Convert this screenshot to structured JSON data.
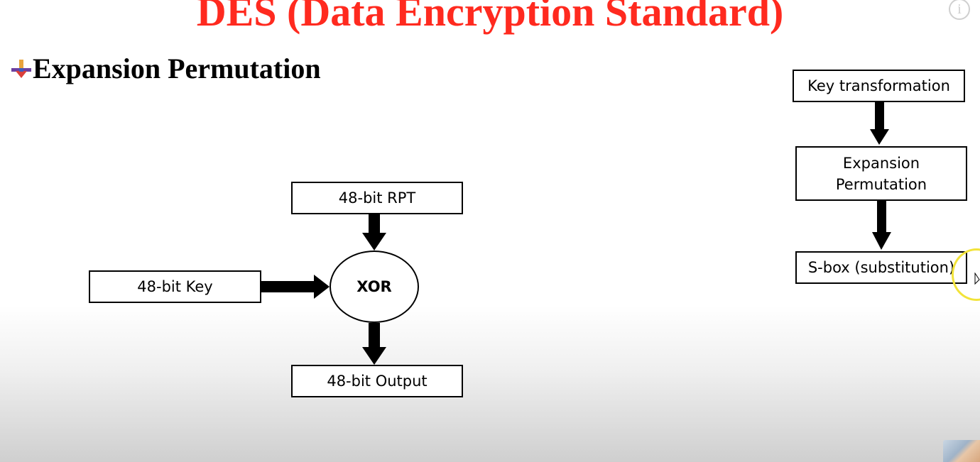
{
  "slide": {
    "title": "DES (Data Encryption Standard)",
    "title_color": "#ff2a1f",
    "heading": "Expansion Permutation",
    "bullet_icon": "arrow-bullet-icon"
  },
  "main_diagram": {
    "rpt_box": "48-bit RPT",
    "key_box": "48-bit Key",
    "xor_node": "XOR",
    "output_box": "48-bit Output"
  },
  "flow_diagram": {
    "steps": [
      {
        "label": "Key transformation"
      },
      {
        "lines": [
          "Expansion",
          "Permutation"
        ]
      },
      {
        "label": "S-box (substitution)"
      }
    ]
  },
  "overlay": {
    "info_icon": "info-icon",
    "info_glyph": "i",
    "cursor_ring_icon": "cursor-highlight-icon",
    "webcam": "webcam-thumbnail"
  }
}
